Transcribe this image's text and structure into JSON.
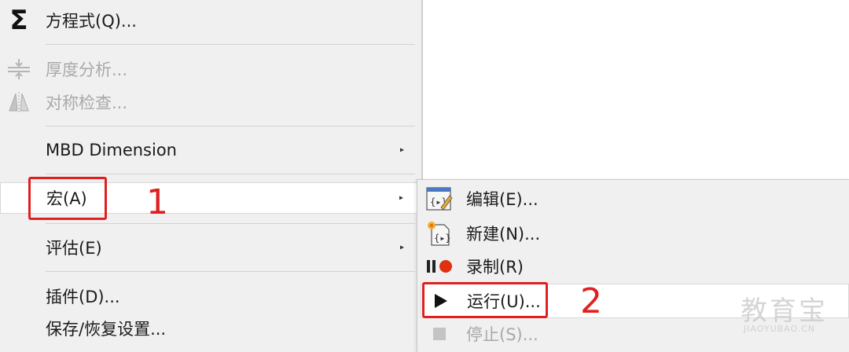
{
  "main_menu": {
    "equation": "方程式(Q)...",
    "thickness": "厚度分析...",
    "symmetry": "对称检查...",
    "mbd": "MBD Dimension",
    "macro": "宏(A)",
    "evaluate": "评估(E)",
    "addins": "插件(D)...",
    "save_restore": "保存/恢复设置..."
  },
  "sub_menu": {
    "edit": "编辑(E)...",
    "new": "新建(N)...",
    "record": "录制(R)",
    "run": "运行(U)...",
    "stop": "停止(S)..."
  },
  "annotations": {
    "step1": "1",
    "step2": "2"
  },
  "watermark": {
    "cn": "教育宝",
    "en": "JIAOYUBAO.CN"
  },
  "icons": {
    "equation": "sigma-icon",
    "thickness": "thickness-analysis-icon",
    "symmetry": "symmetry-check-icon",
    "edit": "macro-edit-icon",
    "new": "macro-new-icon",
    "record": "record-icon",
    "run": "play-icon",
    "stop": "stop-icon"
  },
  "colors": {
    "annotation_red": "#e02020",
    "menu_bg": "#f0f0f0",
    "disabled_text": "#a9a9a9"
  }
}
